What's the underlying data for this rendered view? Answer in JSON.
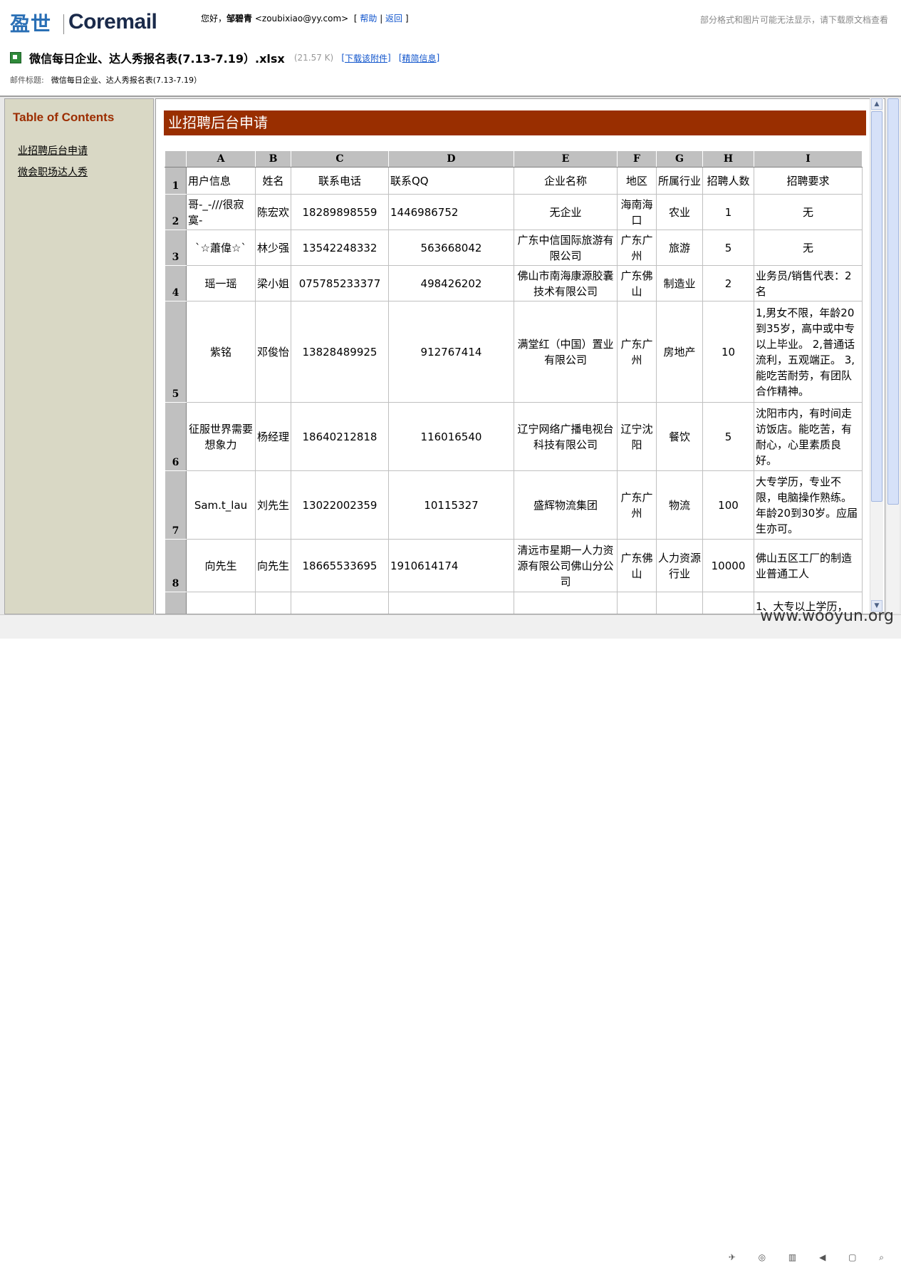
{
  "header": {
    "logo_cn": "盈世",
    "logo_en": "Coremail",
    "greeting": "您好，",
    "user_name": "邹碧青",
    "user_email": "<zoubixiao@yy.com>",
    "help_label": "帮助",
    "back_label": "返回",
    "notice": "部分格式和图片可能无法显示，请下载原文档查看"
  },
  "file": {
    "name": "微信每日企业、达人秀报名表(7.13-7.19）.xlsx",
    "size": "(21.57 K)",
    "download_label": "下载该附件",
    "info_label": "精简信息",
    "subject_label": "邮件标题:",
    "subject_value": "微信每日企业、达人秀报名表(7.13-7.19）"
  },
  "toc": {
    "title": "Table of Contents",
    "items": [
      "业招聘后台申请",
      "微会职场达人秀"
    ]
  },
  "sheet": {
    "title": "业招聘后台申请",
    "columns": [
      "A",
      "B",
      "C",
      "D",
      "E",
      "F",
      "G",
      "H",
      "I"
    ],
    "rows": [
      {
        "n": "1",
        "cells": [
          "用户信息",
          "姓名",
          "联系电话",
          "联系QQ",
          "企业名称",
          "地区",
          "所属行业",
          "招聘人数",
          "招聘要求"
        ]
      },
      {
        "n": "2",
        "cells": [
          "哥-_-///很寂寞-",
          "陈宏欢",
          "18289898559",
          "1446986752",
          "无企业",
          "海南海口",
          "农业",
          "1",
          "无"
        ]
      },
      {
        "n": "3",
        "cells": [
          "`☆蕭偉☆`",
          "林少强",
          "13542248332",
          "563668042",
          "广东中信国际旅游有限公司",
          "广东广州",
          "旅游",
          "5",
          "无"
        ]
      },
      {
        "n": "4",
        "cells": [
          "瑶一瑶",
          "梁小姐",
          "075785233377",
          "498426202",
          "佛山市南海康源胶囊技术有限公司",
          "广东佛山",
          "制造业",
          "2",
          "业务员/销售代表：2名"
        ]
      },
      {
        "n": "5",
        "cells": [
          "紫铭",
          "邓俊怡",
          "13828489925",
          "912767414",
          "满堂红（中国）置业有限公司",
          "广东广州",
          "房地产",
          "10",
          "1,男女不限，年龄20到35岁，高中或中专以上毕业。 2,普通话流利，五观端正。 3,能吃苦耐劳，有团队合作精神。"
        ]
      },
      {
        "n": "6",
        "cells": [
          "征服世界需要想象力",
          "杨经理",
          "18640212818",
          "116016540",
          "辽宁网络广播电视台科技有限公司",
          "辽宁沈阳",
          "餐饮",
          "5",
          "沈阳市内，有时间走访饭店。能吃苦，有耐心，心里素质良好。"
        ]
      },
      {
        "n": "7",
        "cells": [
          "Sam.t_lau",
          "刘先生",
          "13022002359",
          "10115327",
          "盛辉物流集团",
          "广东广州",
          "物流",
          "100",
          "大专学历，专业不限，电脑操作熟练。年龄20到30岁。应届生亦可。"
        ]
      },
      {
        "n": "8",
        "cells": [
          "向先生",
          "向先生",
          "18665533695",
          "1910614174",
          "清远市星期一人力资源有限公司佛山分公司",
          "广东佛山",
          "人力资源行业",
          "10000",
          "佛山五区工厂的制造业普通工人"
        ]
      },
      {
        "n": "",
        "cells": [
          "",
          "",
          "",
          "",
          "",
          "",
          "",
          "",
          "1、大专以上学历，"
        ]
      }
    ]
  },
  "watermark": "www.wooyun.org"
}
